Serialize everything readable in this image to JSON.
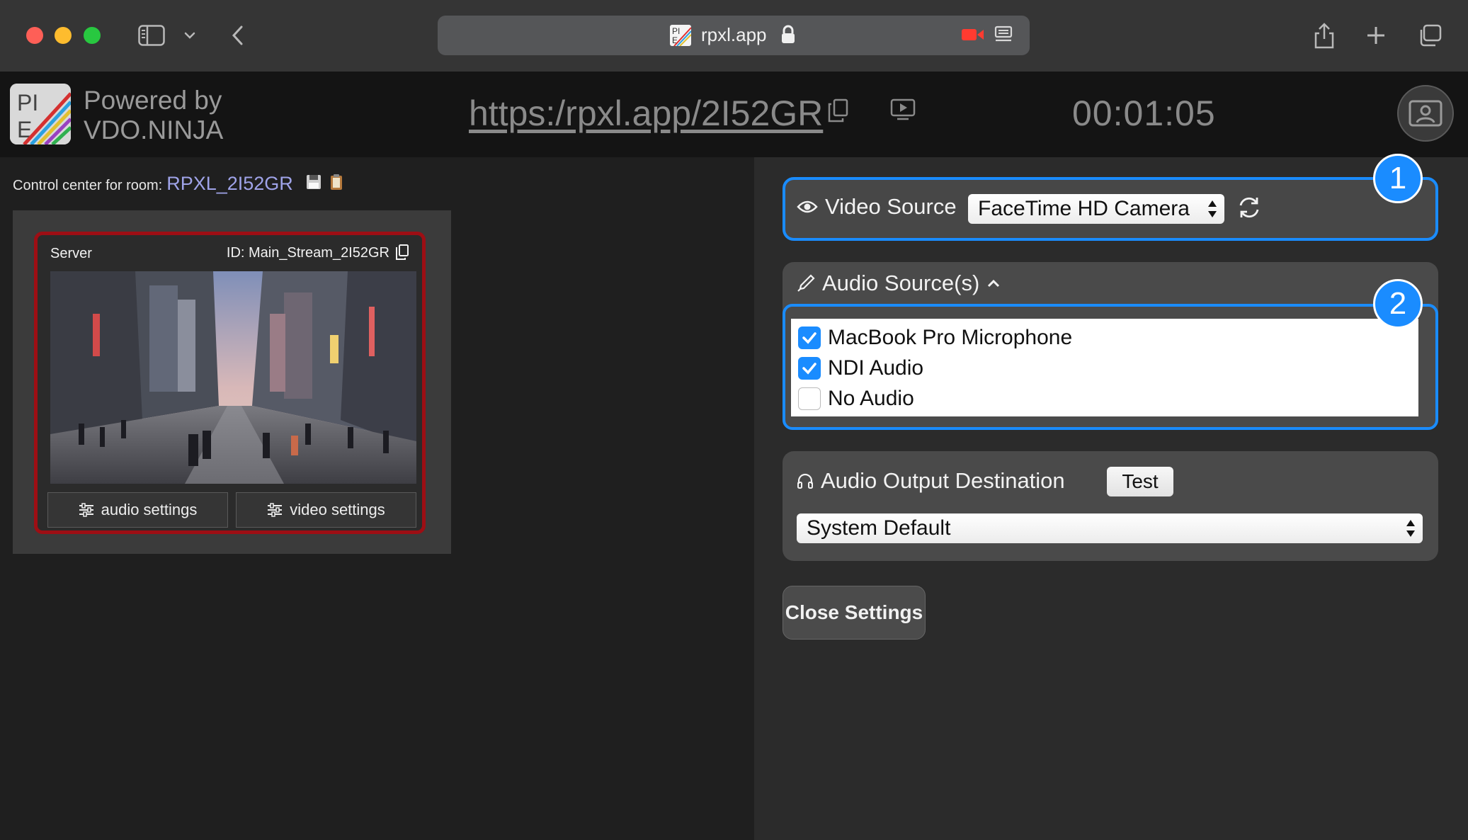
{
  "browser": {
    "host": "rpxl.app",
    "icons": [
      "sidebar-icon",
      "chevron-down-icon",
      "back-icon",
      "lock-icon",
      "camera-recording-icon",
      "reader-icon",
      "share-icon",
      "new-tab-icon",
      "tabs-overview-icon"
    ]
  },
  "header": {
    "powered_line1": "Powered by",
    "powered_line2": "VDO.NINJA",
    "room_link": "https:/rpxl.app/2I52GR",
    "timer": "00:01:05"
  },
  "control": {
    "label": "Control center for room:",
    "room": "RPXL_2I52GR"
  },
  "guest": {
    "label": "Server",
    "id": "ID: Main_Stream_2I52GR",
    "audio_btn": "audio settings",
    "video_btn": "video settings"
  },
  "settings": {
    "video_source": {
      "title": "Video Source",
      "value": "FaceTime HD Camera"
    },
    "audio_sources": {
      "title": "Audio Source(s)",
      "items": [
        {
          "label": "MacBook Pro Microphone",
          "checked": true
        },
        {
          "label": "NDI Audio",
          "checked": true
        },
        {
          "label": "No Audio",
          "checked": false
        }
      ]
    },
    "audio_output": {
      "title": "Audio Output Destination",
      "test": "Test",
      "value": "System Default"
    },
    "close": "Close Settings"
  },
  "badges": {
    "one": "1",
    "two": "2"
  },
  "colors": {
    "accent": "#1a8cff",
    "room_name": "#9fa3e8",
    "card_border": "#9d0e14",
    "recording": "#ff3b30"
  }
}
